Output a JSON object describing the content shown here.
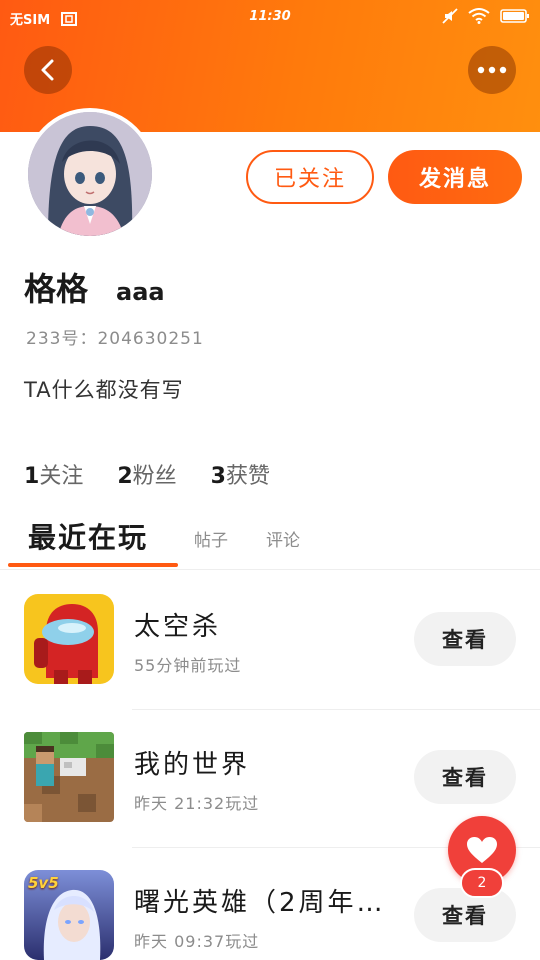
{
  "status_bar": {
    "carrier": "无SIM",
    "time": "11:30"
  },
  "header": {
    "back_icon": "chevron-left-icon",
    "more_icon": "more-horizontal-icon"
  },
  "profile": {
    "follow_label": "已关注",
    "message_label": "发消息",
    "name": "格格",
    "nickname": "aaa",
    "id_text": "233号：204630251",
    "bio": "TA什么都没有写"
  },
  "stats": {
    "following_count": "1",
    "following_label": "关注",
    "fans_count": "2",
    "fans_label": "粉丝",
    "likes_count": "3",
    "likes_label": "获赞"
  },
  "tabs": [
    {
      "label": "最近在玩"
    },
    {
      "label": "帖子"
    },
    {
      "label": "评论"
    }
  ],
  "games": [
    {
      "name": "太空杀",
      "time": "55分钟前玩过",
      "button": "查看"
    },
    {
      "name": "我的世界",
      "time": "昨天 21:32玩过",
      "button": "查看"
    },
    {
      "name": "曙光英雄（2周年…",
      "time": "昨天 09:37玩过",
      "button": "查看",
      "icon_badge": "5v5"
    }
  ],
  "like_fab": {
    "count": "2"
  },
  "colors": {
    "accent": "#ff5a12",
    "like": "#f0403a"
  }
}
